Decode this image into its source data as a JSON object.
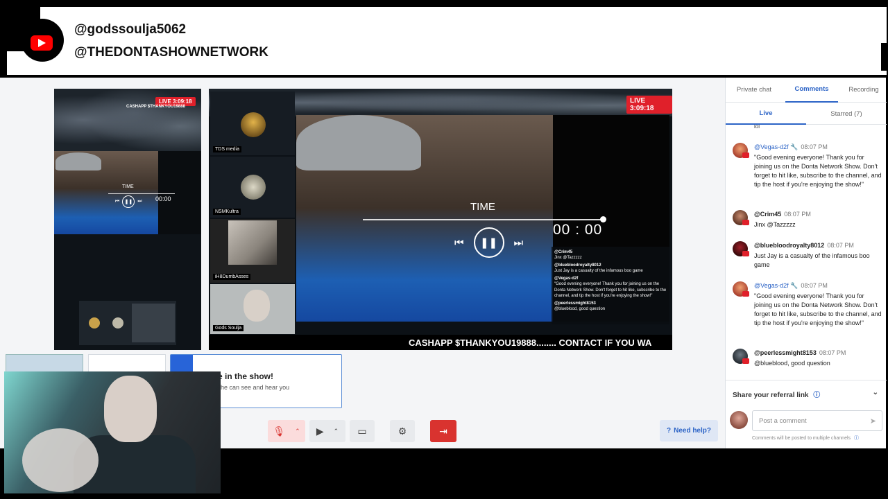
{
  "banner": {
    "handle_primary": "@godssoulja5062",
    "handle_secondary": "@THEDONTASHOWNETWORK"
  },
  "stage": {
    "live_timer": "LIVE 3:09:18",
    "time_label": "TIME",
    "timecode": "00 : 00",
    "small_timecode": "00:00",
    "ticker": "CASHAPP $THANKYOU19888........ CONTACT IF YOU WA",
    "small_ticker": "CASHAPP $THANKYOU19888",
    "tiles": [
      {
        "name": "TDS media"
      },
      {
        "name": "NSMKultra"
      },
      {
        "name": "iH8DumbAsses"
      },
      {
        "name": "Gods Soulja"
      }
    ],
    "overlay_chat": [
      {
        "author": "@Crim45",
        "text": "Jinx @Tazzzzz"
      },
      {
        "author": "@bluebloodroyalty8012",
        "text": "Just Jay is a casualty of the infamous boo game"
      },
      {
        "author": "@Vegas-d2f",
        "text": "\"Good evening everyone! Thank you for joining us on the Donta Network Show. Don't forget to hit like, subscribe to the channel, and tip the host if you're enjoying the show!\""
      },
      {
        "author": "@peerlessmight8153",
        "text": "@blueblood, good question"
      }
    ]
  },
  "invite": {
    "title": "e in the show!",
    "subtitle": "he can see and hear you"
  },
  "controls": {
    "help_label": "Need help?"
  },
  "panel": {
    "tabs": [
      {
        "label": "Private chat"
      },
      {
        "label": "Comments"
      },
      {
        "label": "Recording"
      }
    ],
    "subtabs": [
      {
        "label": "Live"
      },
      {
        "label": "Starred (7)"
      }
    ],
    "truncated_text": "lol",
    "comments": [
      {
        "author": "@Vegas-d2f",
        "time": "08:07 PM",
        "text": "\"Good evening everyone! Thank you for joining us on the Donta Network Show. Don't forget to hit like, subscribe to the channel, and tip the host if you're enjoying the show!\"",
        "moderator": true
      },
      {
        "author": "@Crim45",
        "time": "08:07 PM",
        "text": "Jinx @Tazzzzz",
        "moderator": false
      },
      {
        "author": "@bluebloodroyalty8012",
        "time": "08:07 PM",
        "text": "Just Jay is a casualty of the infamous boo game",
        "moderator": false
      },
      {
        "author": "@Vegas-d2f",
        "time": "08:07 PM",
        "text": "\"Good evening everyone! Thank you for joining us on the Donta Network Show. Don't forget to hit like, subscribe to the channel, and tip the host if you're enjoying the show!\"",
        "moderator": true
      },
      {
        "author": "@peerlessmight8153",
        "time": "08:07 PM",
        "text": "@blueblood, good question",
        "moderator": false
      }
    ],
    "referral_label": "Share your referral link",
    "post_placeholder": "Post a comment",
    "post_note": "Comments will be posted to multiple channels"
  },
  "colors": {
    "accent": "#2b63c6",
    "live_red": "#e0202a",
    "youtube_red": "#ff0000"
  },
  "icons": [
    "youtube-icon",
    "pause-icon",
    "skip-back-icon",
    "skip-forward-icon",
    "mic-off-icon",
    "camera-icon",
    "screen-share-icon",
    "gear-icon",
    "leave-icon",
    "help-icon",
    "chevron-down-icon",
    "send-icon",
    "wrench-icon",
    "info-icon"
  ]
}
